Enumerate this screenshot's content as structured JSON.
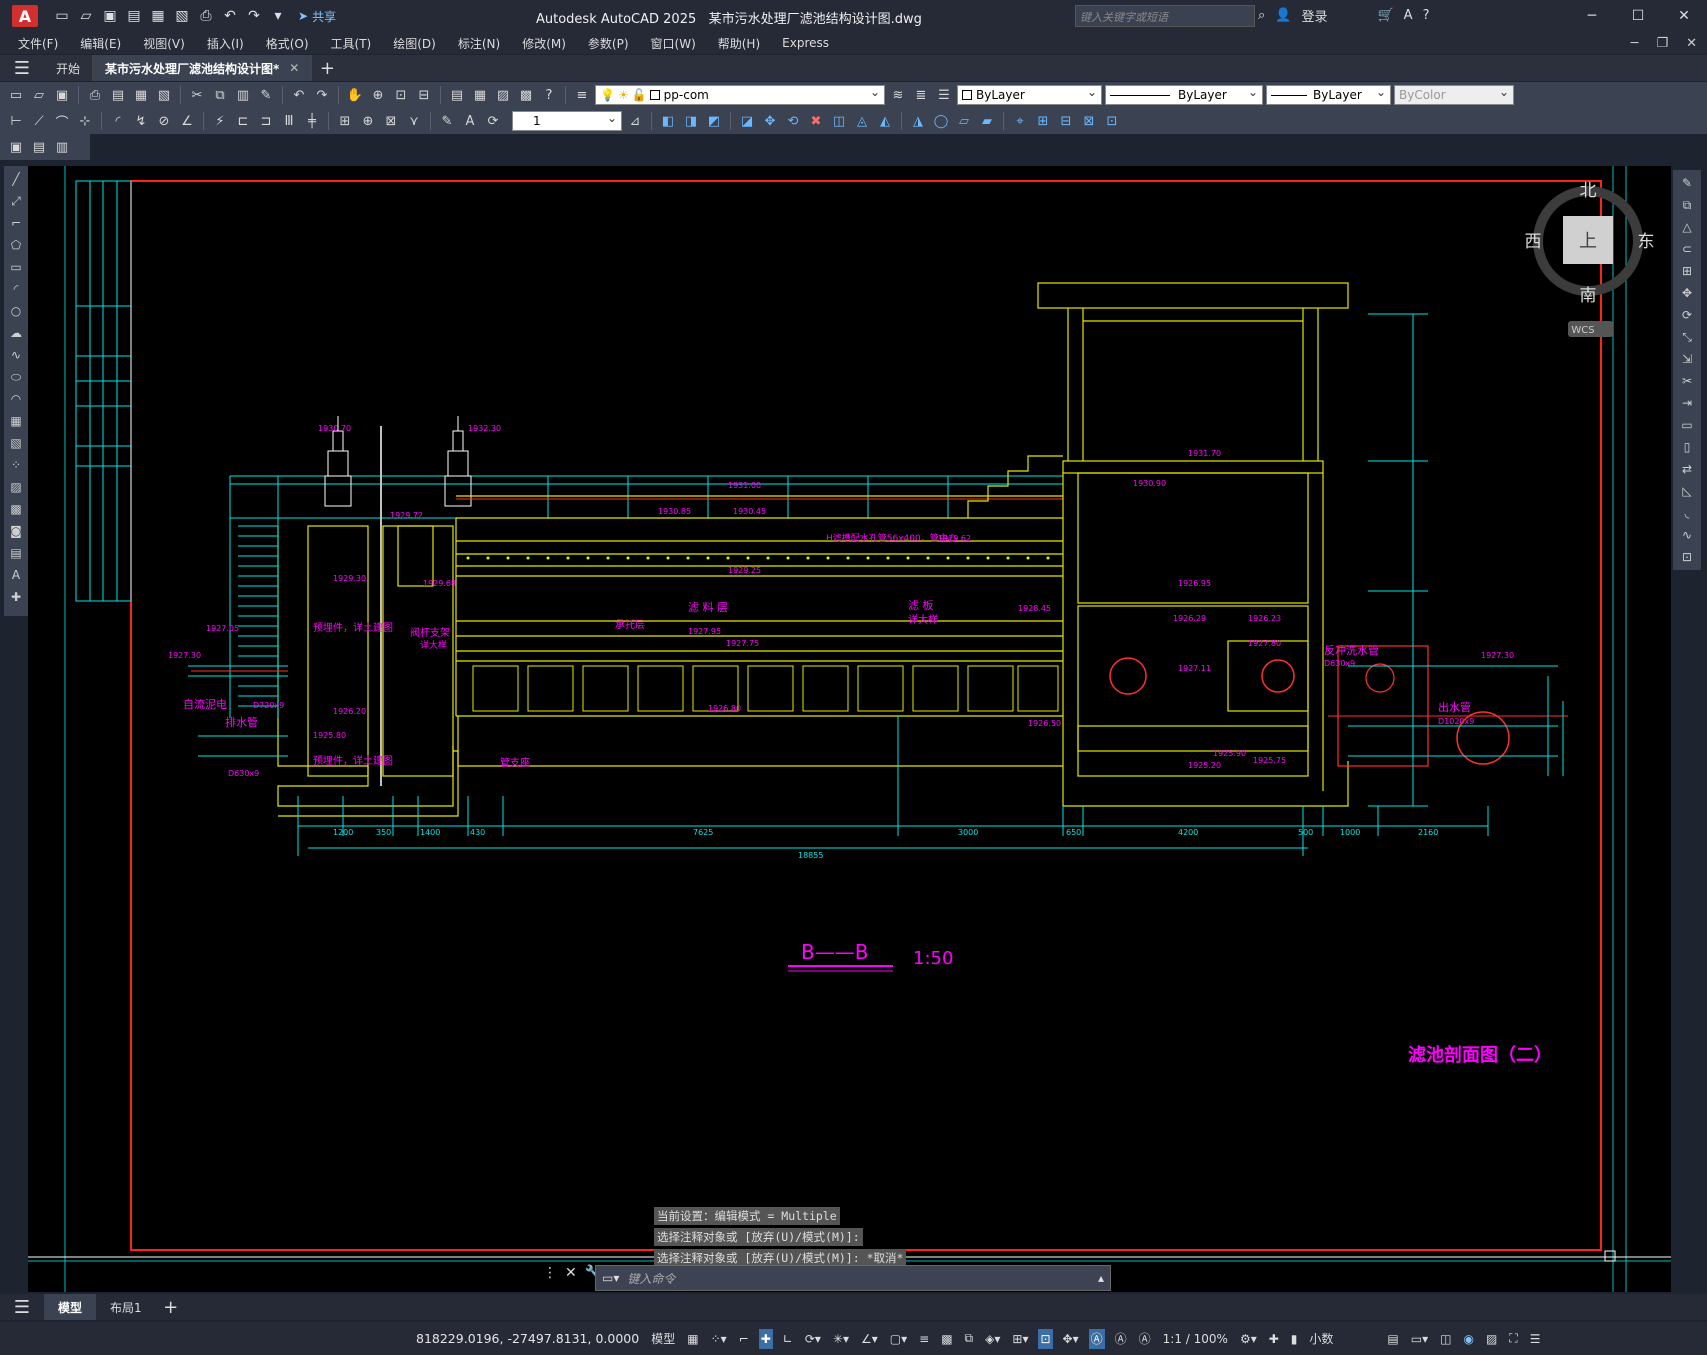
{
  "app": {
    "name": "Autodesk AutoCAD 2025",
    "document": "某市污水处理厂滤池结构设计图.dwg",
    "share": "共享",
    "search_placeholder": "键入关键字或短语",
    "login": "登录"
  },
  "menu": [
    "文件(F)",
    "编辑(E)",
    "视图(V)",
    "插入(I)",
    "格式(O)",
    "工具(T)",
    "绘图(D)",
    "标注(N)",
    "修改(M)",
    "参数(P)",
    "窗口(W)",
    "帮助(H)",
    "Express"
  ],
  "tabs": {
    "start": "开始",
    "active": "某市污水处理厂滤池结构设计图*"
  },
  "toolbar": {
    "layer": "pp-com",
    "color": "ByLayer",
    "linetype": "ByLayer",
    "lineweight": "ByLayer",
    "plotstyle": "ByColor",
    "scale_value": "1"
  },
  "viewcube": {
    "north": "北",
    "south": "南",
    "east": "东",
    "west": "西",
    "top": "上",
    "wcs": "WCS"
  },
  "drawing": {
    "section_label": "B——B",
    "scale": "1:50",
    "sheet_title": "滤池剖面图（二）",
    "labels": [
      "反冲洗水管",
      "D630x9",
      "出水管",
      "D1020x9",
      "自流泥电",
      "排水管",
      "D720x9",
      "D630x9",
      "预埋件，详土建图",
      "预埋件，详土建图",
      "阀杆支架",
      "管支座",
      "滤  料  层",
      "滤  板",
      "承托层",
      "详大样",
      "详大样",
      "H滤槽配水孔管56x400，管中心",
      "1200",
      "7625",
      "3000",
      "4200",
      "18855",
      "2160",
      "1000",
      "1400",
      "350",
      "430",
      "650",
      "500"
    ],
    "elevations": [
      "1930.70",
      "1932.30",
      "1931.00",
      "1930.85",
      "1930.45",
      "1929.72",
      "1929.62",
      "1929.25",
      "1928.45",
      "1927.95",
      "1927.75",
      "1926.80",
      "1926.50",
      "1931.70",
      "1930.90",
      "1926.95",
      "1926.29",
      "1926.23",
      "1927.80",
      "1927.11",
      "1925.90",
      "1925.75",
      "1925.20",
      "1927.30",
      "1927.05",
      "1925.80",
      "1926.20",
      "1927.30",
      "1929.30",
      "1929.68"
    ]
  },
  "command": {
    "history": [
      "当前设置：编辑模式 = Multiple",
      "选择注释对象或 [放弃(U)/模式(M)]:",
      "选择注释对象或 [放弃(U)/模式(M)]: *取消*"
    ],
    "placeholder": "键入命令"
  },
  "layout_tabs": [
    "模型",
    "布局1"
  ],
  "status": {
    "coords": "818229.0196, -27497.8131, 0.0000",
    "model": "模型",
    "scale": "1:1 / 100%",
    "units": "小数"
  },
  "colors": {
    "cad_bg": "#000000",
    "frame_red": "#ff2020",
    "cyan": "#00e5e5",
    "yellow": "#e6e600",
    "magenta": "#ff00ff",
    "ui_dark": "#252a36",
    "ui_mid": "#3b4251"
  }
}
